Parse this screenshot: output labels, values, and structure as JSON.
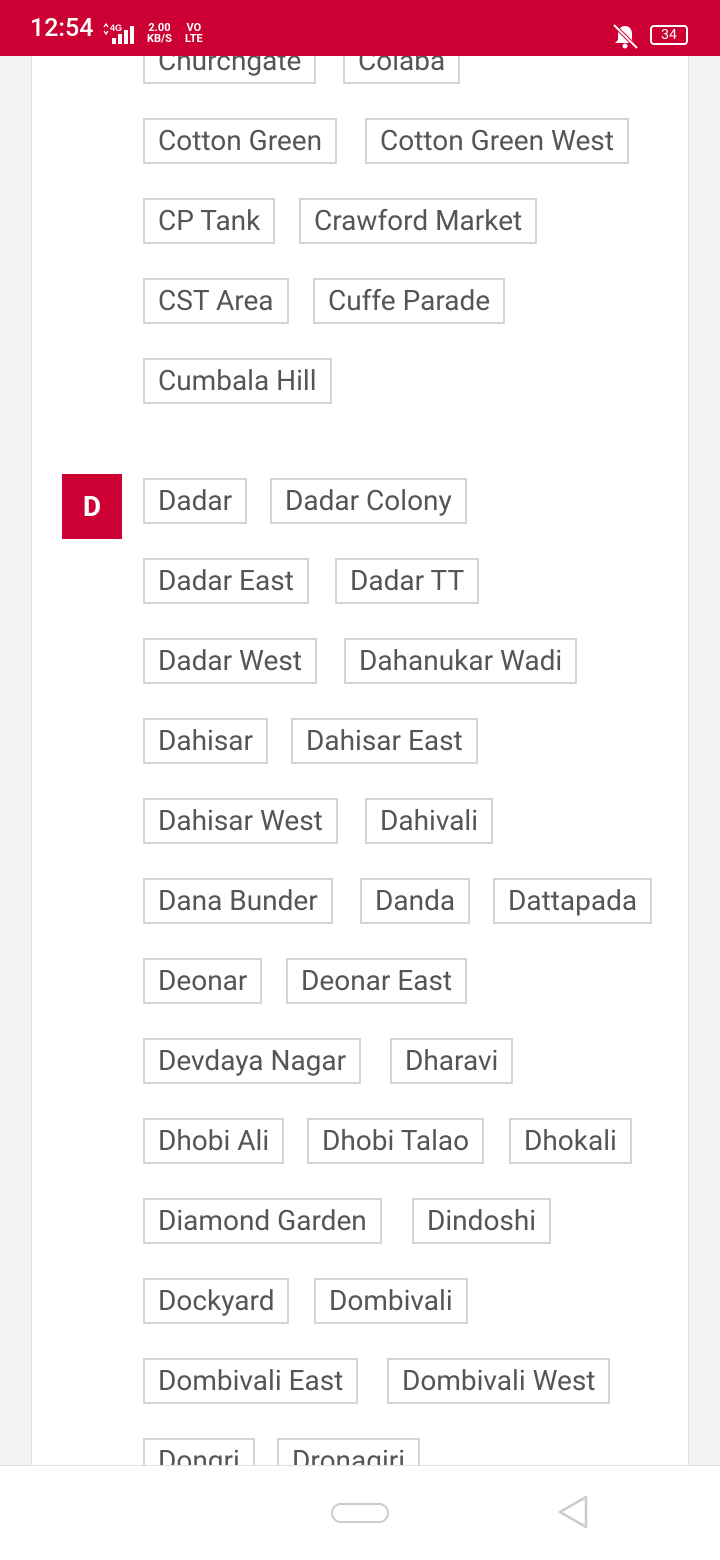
{
  "status_bar": {
    "time": "12:54",
    "network": "4G",
    "speed_value": "2.00",
    "speed_unit": "KB/S",
    "volte_top": "VO",
    "volte_bottom": "LTE",
    "battery": "34"
  },
  "section_c": {
    "chips": [
      "Churchgate",
      "Colaba",
      "Cotton Green",
      "Cotton Green West",
      "CP Tank",
      "Crawford Market",
      "CST Area",
      "Cuffe Parade",
      "Cumbala Hill"
    ]
  },
  "section_d": {
    "letter": "D",
    "chips": [
      "Dadar",
      "Dadar Colony",
      "Dadar East",
      "Dadar TT",
      "Dadar West",
      "Dahanukar Wadi",
      "Dahisar",
      "Dahisar East",
      "Dahisar West",
      "Dahivali",
      "Dana Bunder",
      "Danda",
      "Dattapada",
      "Deonar",
      "Deonar East",
      "Devdaya Nagar",
      "Dharavi",
      "Dhobi Ali",
      "Dhobi Talao",
      "Dhokali",
      "Diamond Garden",
      "Dindoshi",
      "Dockyard",
      "Dombivali",
      "Dombivali East",
      "Dombivali West",
      "Dongri",
      "Dronagiri"
    ]
  },
  "colors": {
    "accent": "#cc0033",
    "chip_border": "#d4d4d4",
    "chip_text": "#555555"
  }
}
